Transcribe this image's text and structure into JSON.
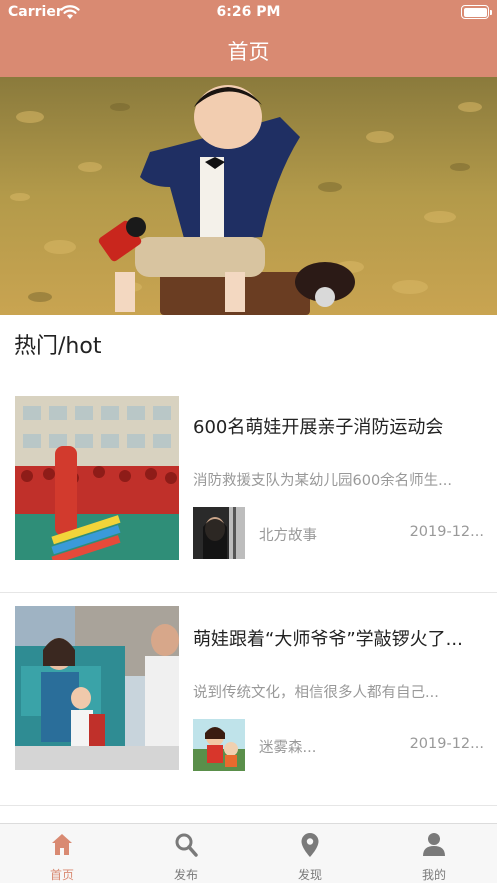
{
  "status_bar": {
    "carrier": "Carrier",
    "time": "6:26 PM"
  },
  "header": {
    "title": "首页"
  },
  "section": {
    "title": "热门/hot"
  },
  "news": [
    {
      "title": "600名萌娃开展亲子消防运动会",
      "summary": "消防救援支队为某幼儿园600余名师生...",
      "author": "北方故事",
      "date": "2019-12..."
    },
    {
      "title": "萌娃跟着“大师爷爷”学敲锣火了...",
      "summary": "说到传统文化，相信很多人都有自己...",
      "author": "迷雾森...",
      "date": "2019-12..."
    }
  ],
  "tabs": [
    {
      "label": "首页",
      "icon": "home-icon",
      "active": true
    },
    {
      "label": "发布",
      "icon": "search-icon",
      "active": false
    },
    {
      "label": "发现",
      "icon": "location-pin-icon",
      "active": false
    },
    {
      "label": "我的",
      "icon": "user-icon",
      "active": false
    }
  ],
  "colors": {
    "accent": "#d98a72",
    "tab_inactive": "#7a7a7a",
    "muted_text": "#999999"
  }
}
